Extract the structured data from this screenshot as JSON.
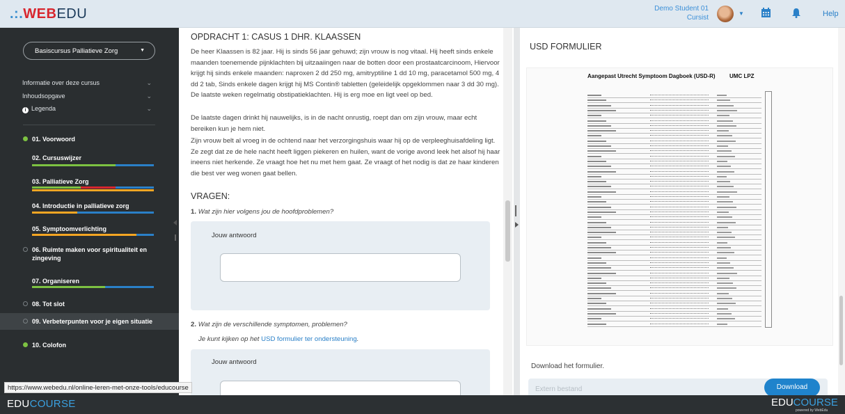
{
  "header": {
    "logo_dots": ".:.",
    "logo_red": "WEB",
    "logo_rest": "EDU",
    "user_name": "Demo Student 01",
    "user_role": "Cursist",
    "help": "Help"
  },
  "sidebar": {
    "course": "Basiscursus Palliatieve Zorg",
    "links": [
      {
        "label": "Informatie over deze cursus"
      },
      {
        "label": "Inhoudsopgave"
      },
      {
        "label": "Legenda"
      }
    ],
    "chapters": [
      {
        "label": "01. Voorwoord",
        "status": "done"
      },
      {
        "label": "02. Cursuswijzer",
        "status": "none"
      },
      {
        "label": "03. Palliatieve Zorg",
        "status": "none"
      },
      {
        "label": "04. Introductie in palliatieve zorg",
        "status": "none"
      },
      {
        "label": "05. Symptoomverlichting",
        "status": "none"
      },
      {
        "label": "06. Ruimte maken voor spiritualiteit en zingeving",
        "status": "open"
      },
      {
        "label": "07. Organiseren",
        "status": "none"
      },
      {
        "label": "08. Tot slot",
        "status": "open"
      },
      {
        "label": "09. Verbeterpunten voor je eigen situatie",
        "status": "open"
      },
      {
        "label": "10. Colofon",
        "status": "done"
      }
    ],
    "colors": {
      "green": "#7dc242",
      "red": "#d8262e",
      "orange": "#f5a623",
      "blue": "#2a80c8"
    }
  },
  "main": {
    "title": "OPDRACHT 1: CASUS 1 DHR. KLAASSEN",
    "p1": "De heer Klaassen is 82 jaar. Hij is sinds 56 jaar gehuwd; zijn vrouw is nog vitaal. Hij heeft sinds enkele maanden toenemende pijnklachten bij uitzaaiingen naar de botten door een prostaatcarcinoom, Hiervoor krijgt hij sinds enkele maanden: naproxen 2 dd 250 mg, amitryptiline 1 dd 10 mg, paracetamol 500 mg, 4 dd 2 tab, Sinds enkele dagen krijgt hij MS Contin® tabletten (geleidelijk opgeklommen naar 3 dd 30 mg). De laatste weken regelmatig obstipatieklachten. Hij is erg moe en ligt veel op bed.",
    "p2": "De laatste dagen drinkt hij nauwelijks, is in de nacht onrustig, roept dan om zijn vrouw, maar echt bereiken kun je hem niet.",
    "p3": "Zijn vrouw belt al vroeg in de ochtend naar het verzorgingshuis waar hij op de verpleeghuisafdeling ligt. Ze zegt dat ze de hele nacht heeft liggen piekeren en huilen, want de vorige avond leek het alsof hij haar ineens niet herkende. Ze vraagt hoe het nu met hem gaat. Ze vraagt of het nodig is dat ze haar kinderen die best ver weg wonen gaat bellen.",
    "vragen": "VRAGEN:",
    "q1_num": "1.",
    "q1": "Wat zijn hier volgens jou de hoofdproblemen?",
    "answer_label": "Jouw antwoord",
    "q2_num": "2.",
    "q2": "Wat zijn de verschillende symptomen, problemen?",
    "q2_hint_pre": "Je kunt kijken op het",
    "q2_hint_link": "USD formulier ter ondersteuning",
    "q2_hint_post": "."
  },
  "panel": {
    "title": "USD FORMULIER",
    "doc_title": "Aangepast Utrecht Symptoom Dagboek (USD-R)",
    "doc_org": "UMC LPZ",
    "download_label": "Download het formulier.",
    "ext_placeholder": "Extern bestand",
    "download_button": "Download"
  },
  "status_url": "https://www.webedu.nl/online-leren-met-onze-tools/educourse",
  "footer": {
    "left_a": "EDU",
    "left_b": "COURSE",
    "right_a": "EDU",
    "right_b": "COURSE",
    "powered": "powered by WebEdu"
  }
}
